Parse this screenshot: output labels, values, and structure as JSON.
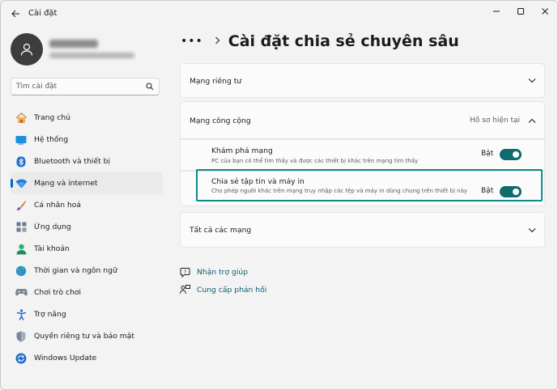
{
  "window": {
    "app_title": "Cài đặt"
  },
  "search": {
    "placeholder": "Tìm cài đặt"
  },
  "sidebar": {
    "items": [
      {
        "label": "Trang chủ",
        "icon": "home-icon",
        "active": false
      },
      {
        "label": "Hệ thống",
        "icon": "system-icon",
        "active": false
      },
      {
        "label": "Bluetooth và thiết bị",
        "icon": "bluetooth-icon",
        "active": false
      },
      {
        "label": "Mạng và internet",
        "icon": "network-icon",
        "active": true
      },
      {
        "label": "Cá nhân hoá",
        "icon": "brush-icon",
        "active": false
      },
      {
        "label": "Ứng dụng",
        "icon": "apps-icon",
        "active": false
      },
      {
        "label": "Tài khoản",
        "icon": "account-icon",
        "active": false
      },
      {
        "label": "Thời gian và ngôn ngữ",
        "icon": "globe-icon",
        "active": false
      },
      {
        "label": "Chơi trò chơi",
        "icon": "gamepad-icon",
        "active": false
      },
      {
        "label": "Trợ năng",
        "icon": "accessibility-icon",
        "active": false
      },
      {
        "label": "Quyền riêng tư và bảo mật",
        "icon": "shield-icon",
        "active": false
      },
      {
        "label": "Windows Update",
        "icon": "update-icon",
        "active": false
      }
    ]
  },
  "main": {
    "breadcrumb_more": "•••",
    "page_title": "Cài đặt chia sẻ chuyên sâu",
    "private_network": {
      "title": "Mạng riêng tư"
    },
    "public_network": {
      "title": "Mạng công cộng",
      "status": "Hồ sơ hiện tại",
      "settings": [
        {
          "title": "Khám phá mạng",
          "description": "PC của bạn có thể tìm thấy và được các thiết bị khác trên mạng tìm thấy",
          "state_label": "Bật",
          "on": true
        },
        {
          "title": "Chia sẻ tập tin và máy in",
          "description": "Cho phép người khác trên mạng truy nhập các tệp và máy in dùng chung trên thiết bị này",
          "state_label": "Bật",
          "on": true
        }
      ]
    },
    "all_networks": {
      "title": "Tất cả các mạng"
    },
    "links": [
      {
        "label": "Nhận trợ giúp",
        "icon": "help-icon"
      },
      {
        "label": "Cung cấp phản hồi",
        "icon": "feedback-icon"
      }
    ]
  },
  "colors": {
    "accent": "#0e6b6e",
    "active_indicator": "#0067c0",
    "link": "#0b5f70"
  }
}
